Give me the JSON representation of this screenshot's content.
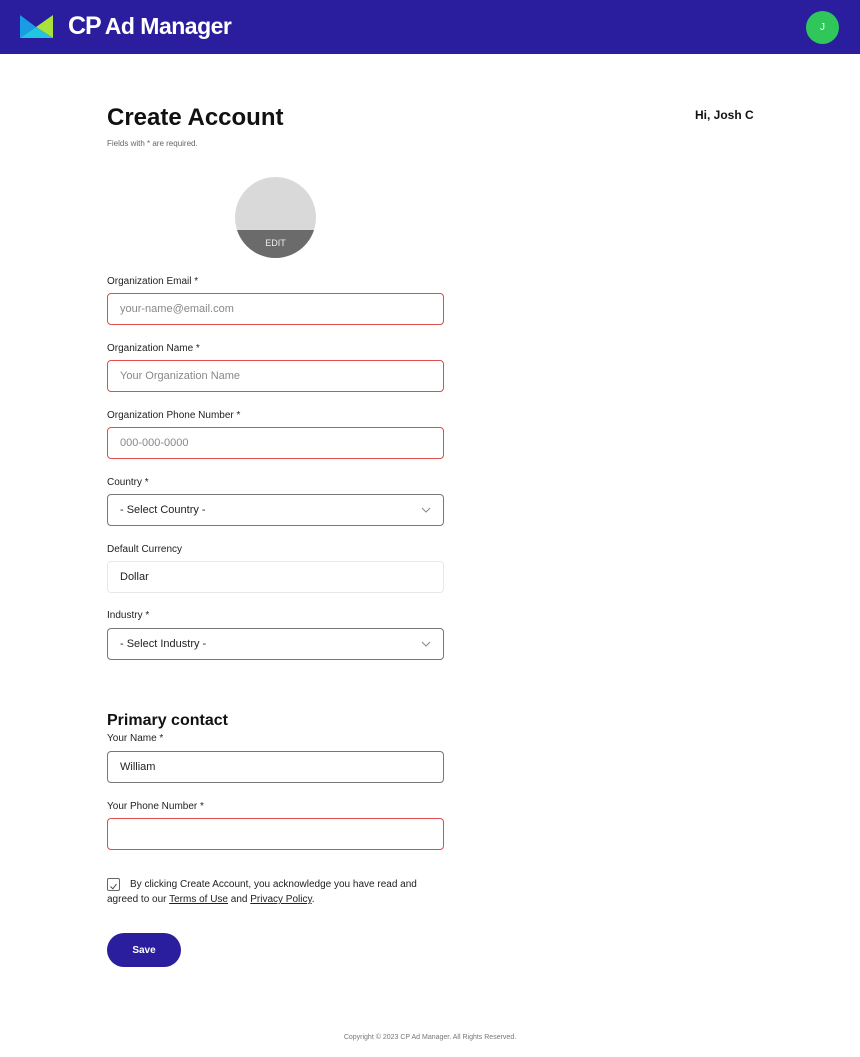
{
  "header": {
    "brand_cp": "CP",
    "brand_rest": "Ad Manager",
    "avatar_initial": "J",
    "colors": {
      "bar": "#2a1d9e",
      "avatar": "#2fc75a"
    }
  },
  "greeting": "Hi, Josh C",
  "page": {
    "title": "Create Account",
    "subtitle": "Fields with * are required.",
    "photo_edit_label": "EDIT"
  },
  "form": {
    "org_email": {
      "label": "Organization Email *",
      "placeholder": "your-name@email.com",
      "value": ""
    },
    "org_name": {
      "label": "Organization Name *",
      "placeholder": "Your Organization Name",
      "value": ""
    },
    "org_phone": {
      "label": "Organization Phone Number *",
      "placeholder": "000-000-0000",
      "value": ""
    },
    "country": {
      "label": "Country *",
      "selected": "- Select Country -"
    },
    "currency": {
      "label": "Default Currency",
      "value": "Dollar"
    },
    "industry": {
      "label": "Industry *",
      "selected": "- Select Industry -"
    }
  },
  "primary_contact": {
    "heading": "Primary contact",
    "name": {
      "label": "Your Name *",
      "value": "William"
    },
    "phone": {
      "label": "Your Phone Number *",
      "value": ""
    }
  },
  "consent": {
    "checked": true,
    "text_before": "By clicking Create Account, you acknowledge you have read and agreed to our ",
    "terms_link": "Terms of Use",
    "and": " and ",
    "privacy_link": "Privacy Policy",
    "end": "."
  },
  "actions": {
    "save_label": "Save"
  },
  "footer": {
    "copyright": "Copyright © 2023 CP Ad Manager. All Rights Reserved."
  }
}
